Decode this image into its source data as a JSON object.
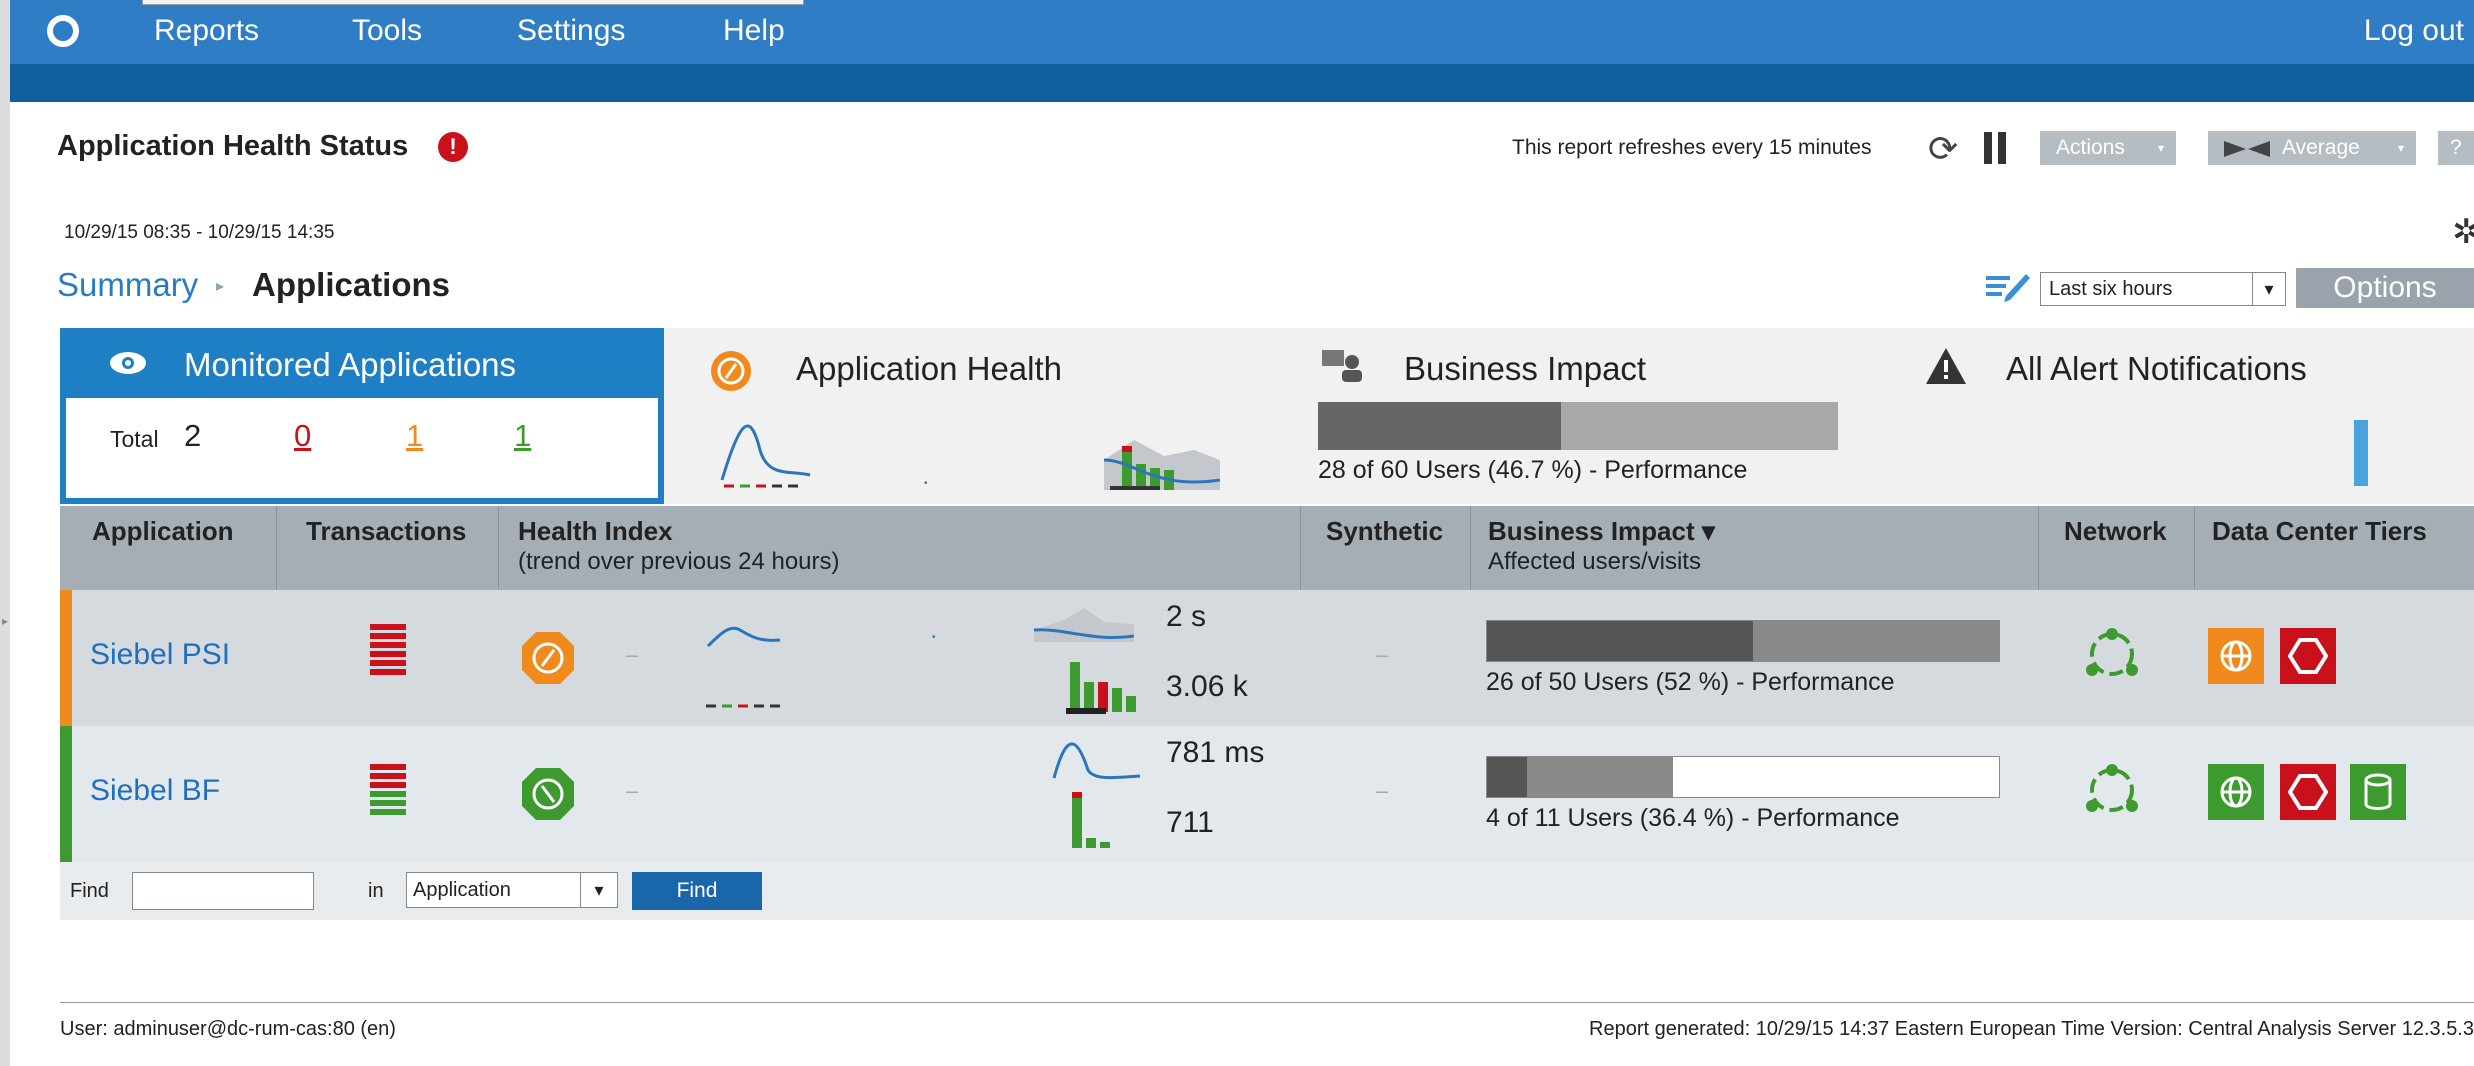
{
  "nav": {
    "items": [
      "Reports",
      "Tools",
      "Settings",
      "Help"
    ],
    "logout": "Log out",
    "brand_color": "#2f7dc5"
  },
  "header": {
    "title": "Application Health Status",
    "alert_glyph": "!",
    "refresh_text": "This report refreshes every 15 minutes",
    "actions_label": "Actions",
    "average_label": "Average",
    "help_label": "?"
  },
  "date_range": "10/29/15 08:35 - 10/29/15 14:35",
  "breadcrumb": {
    "summary": "Summary",
    "current": "Applications"
  },
  "time_select": {
    "value": "Last six hours"
  },
  "options_label": "Options",
  "tabs": {
    "monitored": {
      "label": "Monitored Applications",
      "total_label": "Total",
      "total": "2",
      "red": "0",
      "orange": "1",
      "green": "1"
    },
    "health": {
      "label": "Application Health"
    },
    "business": {
      "label": "Business Impact",
      "bar_fraction": 0.467,
      "text": "28 of 60 Users (46.7 %) - Performance"
    },
    "alerts": {
      "label": "All Alert Notifications"
    }
  },
  "table": {
    "headers": {
      "application": "Application",
      "transactions": "Transactions",
      "health_index": "Health Index",
      "health_index_sub": "(trend over previous 24 hours)",
      "synthetic": "Synthetic",
      "business_impact": "Business Impact ▾",
      "business_impact_sub": "Affected users/visits",
      "network": "Network",
      "tiers": "Data Center Tiers"
    },
    "rows": [
      {
        "name": "Siebel PSI",
        "status_color": "#f08a1c",
        "response_time": "2 s",
        "volume": "3.06 k",
        "synthetic": "–",
        "health_dash": "–",
        "impact_text": "26 of 50 Users (52 %) - Performance",
        "impact_fraction": 0.52
      },
      {
        "name": "Siebel BF",
        "status_color": "#3d9a2e",
        "response_time": "781 ms",
        "volume": "711",
        "synthetic": "–",
        "health_dash": "–",
        "impact_text": "4 of 11 Users (36.4 %) - Performance",
        "impact_fraction": 0.364
      }
    ]
  },
  "find": {
    "label": "Find",
    "in_label": "in",
    "field_value": "",
    "select_value": "Application",
    "button": "Find"
  },
  "footer": {
    "user": "User:  adminuser@dc-rum-cas:80 (en)",
    "generated": "Report generated: 10/29/15 14:37 Eastern European Time   Version: Central Analysis Server 12.3.5.3"
  }
}
